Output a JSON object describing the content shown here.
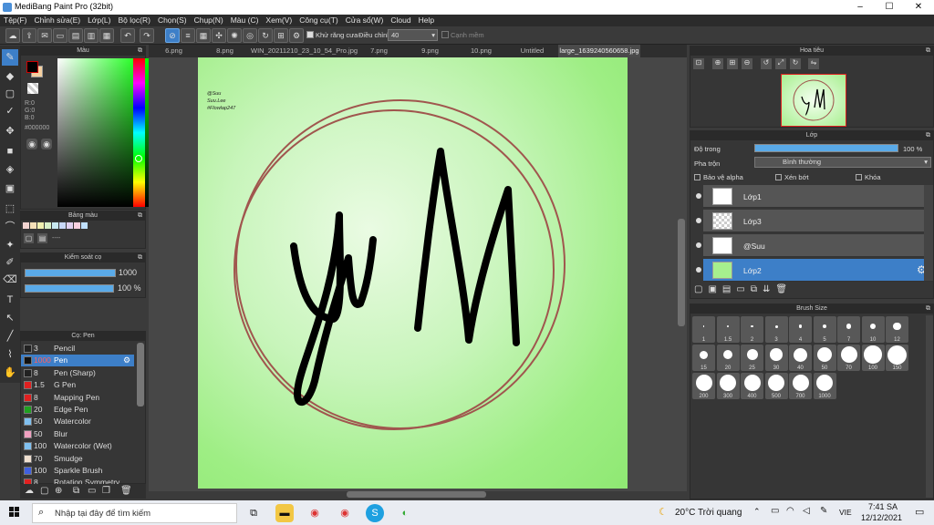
{
  "window": {
    "title": "MediBang Paint Pro (32bit)",
    "minimize": "–",
    "maximize": "☐",
    "close": "✕"
  },
  "menu": [
    "Tệp(F)",
    "Chỉnh sửa(E)",
    "Lớp(L)",
    "Bộ lọc(R)",
    "Chọn(S)",
    "Chụp(N)",
    "Màu (C)",
    "Xem(V)",
    "Công cụ(T)",
    "Cửa sổ(W)",
    "Cloud",
    "Help"
  ],
  "toolbar": {
    "antialias_label": "Khử răng cưa",
    "adjust_label": "Điều chỉnh",
    "adjust_value": "40",
    "edge_label": "Cạnh mềm"
  },
  "tabs": [
    "6.png",
    "8.png",
    "WIN_20211210_23_10_54_Pro.jpg",
    "7.png",
    "9.png",
    "10.png",
    "Untitled",
    "large_1639240560658.jpg"
  ],
  "color_panel": {
    "title": "Màu",
    "r": "R:0",
    "g": "G:0",
    "b": "B:0",
    "hex": "#000000",
    "primary": "#000000",
    "secondary": "#ffffff"
  },
  "swatch_panel": {
    "title": "Bảng màu",
    "colors": [
      "#f2d4d0",
      "#f5e0b8",
      "#f0f0b0",
      "#d8f0c8",
      "#c8e8f0",
      "#c8d8f8",
      "#e0d0f0",
      "#f8d0e0",
      "#c0e0ff"
    ],
    "palette_name": "----"
  },
  "brush_control": {
    "title": "Kiểm soát cọ",
    "size": "1000",
    "opacity": "100 %"
  },
  "brush_list": {
    "title": "Cọ: Pen",
    "items": [
      {
        "size": "3",
        "name": "Pencil",
        "color": "#222222"
      },
      {
        "size": "1000",
        "name": "Pen",
        "color": "#111111"
      },
      {
        "size": "8",
        "name": "Pen (Sharp)",
        "color": "#222222"
      },
      {
        "size": "1.5",
        "name": "G Pen",
        "color": "#e02020"
      },
      {
        "size": "8",
        "name": "Mapping Pen",
        "color": "#e02020"
      },
      {
        "size": "20",
        "name": "Edge Pen",
        "color": "#20a020"
      },
      {
        "size": "50",
        "name": "Watercolor",
        "color": "#80c0f0"
      },
      {
        "size": "50",
        "name": "Blur",
        "color": "#f0a0c0"
      },
      {
        "size": "100",
        "name": "Watercolor (Wet)",
        "color": "#80c0f0"
      },
      {
        "size": "70",
        "name": "Smudge",
        "color": "#f0e0d0"
      },
      {
        "size": "100",
        "name": "Sparkle Brush",
        "color": "#4060e0"
      },
      {
        "size": "8",
        "name": "Rotation Symmetry Pen",
        "color": "#e02020"
      }
    ]
  },
  "canvas_text": {
    "line1": "@Suu",
    "line2": "Suu.Lee",
    "line3": "#Flowlap247"
  },
  "navigator": {
    "title": "Hoa tiêu"
  },
  "layers": {
    "title": "Lớp",
    "opacity_label": "Độ trong",
    "opacity_value": "100 %",
    "blend_label": "Pha trộn",
    "blend_value": "Bình thường",
    "protect_alpha": "Bảo vệ alpha",
    "clipping": "Xén bớt",
    "lock": "Khóa",
    "items": [
      "Lớp1",
      "Lớp3",
      "@Suu",
      "Lớp2"
    ]
  },
  "brush_size": {
    "title": "Brush Size",
    "sizes": [
      "1",
      "1.5",
      "2",
      "3",
      "4",
      "5",
      "7",
      "10",
      "12",
      "15",
      "20",
      "25",
      "30",
      "40",
      "50",
      "70",
      "100",
      "150",
      "200",
      "300",
      "400",
      "500",
      "700",
      "1000"
    ]
  },
  "taskbar": {
    "search_placeholder": "Nhập tại đây để tìm kiếm",
    "weather": "20°C  Trời quang",
    "lang": "VIE",
    "time": "7:41 SA",
    "date": "12/12/2021"
  }
}
